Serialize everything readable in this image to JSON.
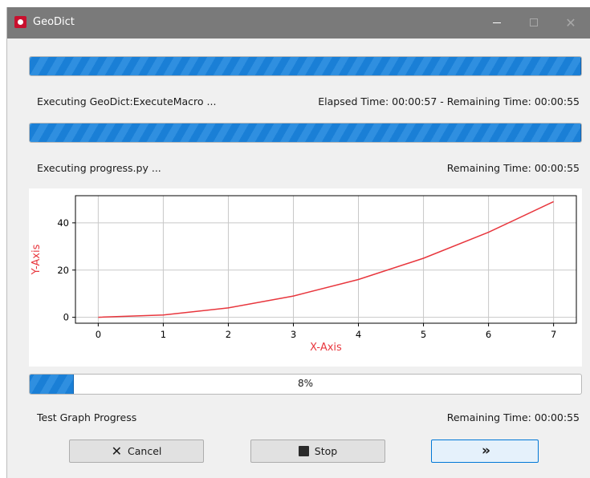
{
  "window": {
    "title": "GeoDict",
    "minimize_glyph": "—",
    "maximize_glyph": "☐",
    "close_glyph": "✕"
  },
  "progress1": {
    "percent": 100,
    "left_text": "Executing GeoDict:ExecuteMacro ...",
    "right_text": "Elapsed Time: 00:00:57 - Remaining Time: 00:00:55"
  },
  "progress2": {
    "percent": 100,
    "left_text": "Executing progress.py ...",
    "right_text": "Remaining Time: 00:00:55"
  },
  "chart_data": {
    "type": "line",
    "title": "",
    "xlabel": "X-Axis",
    "ylabel": "Y-Axis",
    "x": [
      0,
      1,
      2,
      3,
      4,
      5,
      6,
      7
    ],
    "series": [
      {
        "values": [
          0,
          1,
          4,
          9,
          16,
          25,
          36,
          49
        ],
        "color": "#e8363d"
      }
    ],
    "xlim": [
      -0.35,
      7.35
    ],
    "ylim": [
      -2.5,
      51.5
    ],
    "xticks": [
      0,
      1,
      2,
      3,
      4,
      5,
      6,
      7
    ],
    "yticks": [
      0,
      20,
      40
    ],
    "grid": true,
    "label_color": "#e8363d"
  },
  "progress3": {
    "percent": 8,
    "label": "8%",
    "left_text": "Test Graph Progress",
    "right_text": "Remaining Time: 00:00:55"
  },
  "buttons": {
    "cancel": {
      "label": "Cancel",
      "icon": "cancel-icon"
    },
    "stop": {
      "label": "Stop",
      "icon": "stop-icon"
    },
    "next": {
      "icon": "double-chevron-right-icon"
    }
  },
  "colors": {
    "accent": "#1a7fd6",
    "titlebar": "#7a7a7a",
    "brand": "#c8102e"
  }
}
